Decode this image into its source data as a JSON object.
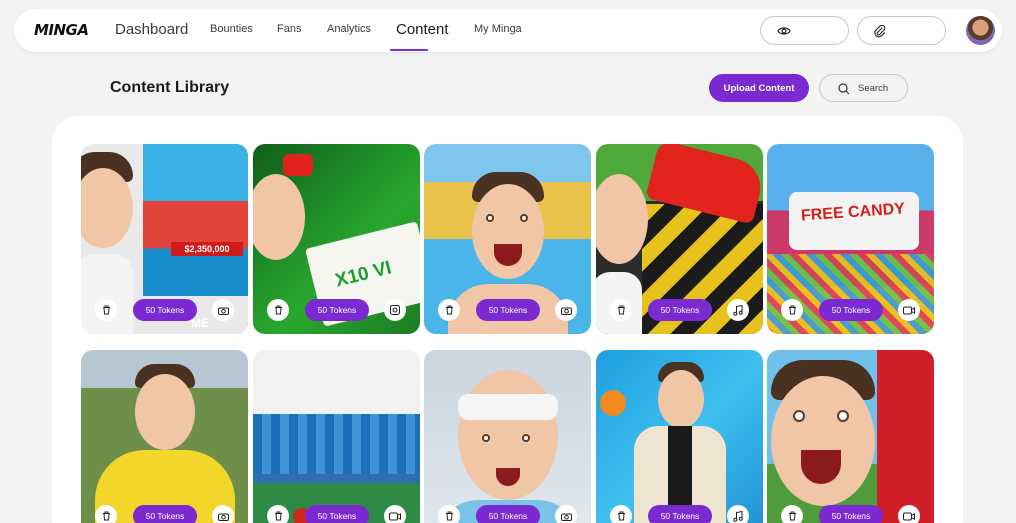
{
  "brand": {
    "logo_text": "MINGA"
  },
  "nav": {
    "items": [
      {
        "label": "Dashboard"
      },
      {
        "label": "Bounties"
      },
      {
        "label": "Fans"
      },
      {
        "label": "Analytics"
      },
      {
        "label": "Content",
        "active": true
      },
      {
        "label": "My Minga"
      }
    ]
  },
  "header_actions": {
    "view_icon": "eye-icon",
    "attach_icon": "paperclip-icon"
  },
  "library": {
    "title": "Content Library",
    "upload_label": "Upload Content",
    "search_label": "Search"
  },
  "cards": [
    {
      "tokens": "50 Tokens",
      "type_icon": "camera-icon"
    },
    {
      "tokens": "50 Tokens",
      "type_icon": "image-icon"
    },
    {
      "tokens": "50 Tokens",
      "type_icon": "camera-icon"
    },
    {
      "tokens": "50 Tokens",
      "type_icon": "music-icon"
    },
    {
      "tokens": "50 Tokens",
      "type_icon": "video-icon"
    },
    {
      "tokens": "50 Tokens",
      "type_icon": "camera-icon"
    },
    {
      "tokens": "50 Tokens",
      "type_icon": "video-icon"
    },
    {
      "tokens": "50 Tokens",
      "type_icon": "camera-icon"
    },
    {
      "tokens": "50 Tokens",
      "type_icon": "music-icon"
    },
    {
      "tokens": "50 Tokens",
      "type_icon": "video-icon"
    }
  ],
  "thumb_text": {
    "card1_price": "$2,350,000",
    "card1_me": "ME",
    "card2_sign": "X10 VI",
    "card5_sign": "FREE CANDY"
  },
  "colors": {
    "accent": "#7a2ad0"
  }
}
